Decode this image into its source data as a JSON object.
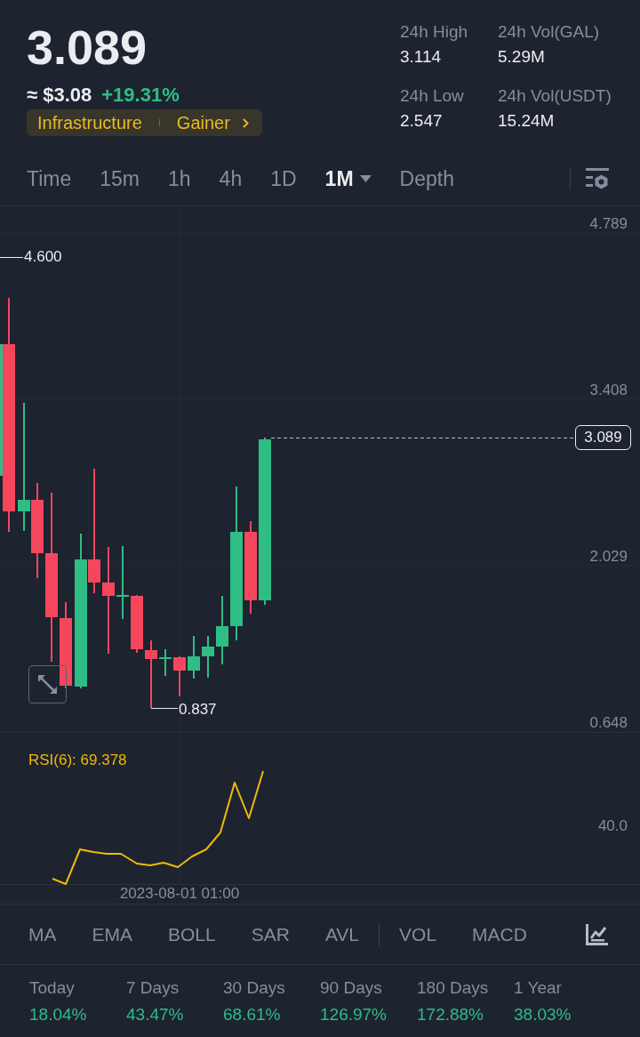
{
  "ticker": {
    "price": "3.089",
    "fiat_price": "≈ $3.08",
    "change": "+19.31%",
    "tags": [
      "Infrastructure",
      "Gainer"
    ],
    "stats": [
      {
        "label": "24h High",
        "value": "3.114"
      },
      {
        "label": "24h Vol(GAL)",
        "value": "5.29M"
      },
      {
        "label": "24h Low",
        "value": "2.547"
      },
      {
        "label": "24h Vol(USDT)",
        "value": "15.24M"
      }
    ]
  },
  "intervals": [
    {
      "label": "Time",
      "selected": false,
      "dropdown": false
    },
    {
      "label": "15m",
      "selected": false,
      "dropdown": false
    },
    {
      "label": "1h",
      "selected": false,
      "dropdown": false
    },
    {
      "label": "4h",
      "selected": false,
      "dropdown": false
    },
    {
      "label": "1D",
      "selected": false,
      "dropdown": false
    },
    {
      "label": "1M",
      "selected": true,
      "dropdown": true
    },
    {
      "label": "Depth",
      "selected": false,
      "dropdown": false
    }
  ],
  "price_chart": {
    "axis_labels": [
      "4.789",
      "3.408",
      "2.029",
      "0.648"
    ],
    "high_label": "4.600",
    "low_label": "0.837",
    "last_price": "3.089"
  },
  "rsi_panel": {
    "label": "RSI(6): 69.378",
    "axis_label": "40.0",
    "time_label": "2023-08-01 01:00"
  },
  "indicators": {
    "main": [
      {
        "label": "MA",
        "selected": false
      },
      {
        "label": "EMA",
        "selected": false
      },
      {
        "label": "BOLL",
        "selected": false
      },
      {
        "label": "SAR",
        "selected": false
      },
      {
        "label": "AVL",
        "selected": false
      }
    ],
    "sub": [
      {
        "label": "VOL",
        "selected": false
      },
      {
        "label": "MACD",
        "selected": false
      }
    ]
  },
  "performance": [
    {
      "period": "Today",
      "change": "18.04%"
    },
    {
      "period": "7 Days",
      "change": "43.47%"
    },
    {
      "period": "30 Days",
      "change": "68.61%"
    },
    {
      "period": "90 Days",
      "change": "126.97%"
    },
    {
      "period": "180 Days",
      "change": "172.88%"
    },
    {
      "period": "1 Year",
      "change": "38.03%"
    }
  ]
}
